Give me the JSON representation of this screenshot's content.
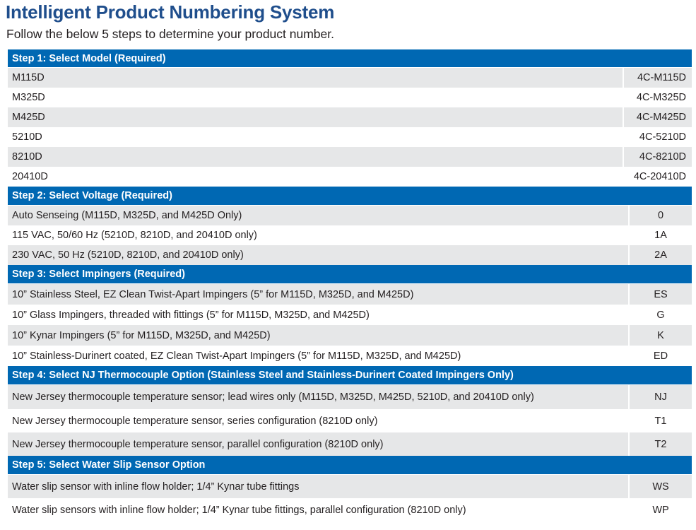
{
  "title": "Intelligent Product Numbering System",
  "subtitle": "Follow the below 5 steps to determine your product number.",
  "colors": {
    "header_bg": "#0068b3",
    "title": "#1f4e8c",
    "row_shade": "#e6e7e8"
  },
  "steps": [
    {
      "label": "Step 1:  Select Model (Required)",
      "rows": [
        {
          "desc": "M115D",
          "code": "4C-M115D"
        },
        {
          "desc": "M325D",
          "code": "4C-M325D"
        },
        {
          "desc": "M425D",
          "code": "4C-M425D"
        },
        {
          "desc": "5210D",
          "code": "4C-5210D"
        },
        {
          "desc": "8210D",
          "code": "4C-8210D"
        },
        {
          "desc": "20410D",
          "code": "4C-20410D"
        }
      ]
    },
    {
      "label": "Step 2:  Select Voltage (Required)",
      "rows": [
        {
          "desc": "Auto Senseing (M115D, M325D, and M425D Only)",
          "code": "0"
        },
        {
          "desc": "115 VAC, 50/60 Hz (5210D, 8210D, and 20410D only)",
          "code": "1A"
        },
        {
          "desc": "230 VAC, 50 Hz (5210D, 8210D, and 20410D only)",
          "code": "2A"
        }
      ]
    },
    {
      "label": "Step 3: Select Impingers (Required)",
      "rows": [
        {
          "desc": "10” Stainless Steel, EZ Clean Twist-Apart Impingers (5” for M115D, M325D, and M425D)",
          "code": "ES"
        },
        {
          "desc": "10” Glass Impingers, threaded with fittings (5” for M115D, M325D, and M425D)",
          "code": "G"
        },
        {
          "desc": "10” Kynar Impingers (5” for M115D, M325D, and M425D)",
          "code": "K"
        },
        {
          "desc": "10” Stainless-Durinert coated, EZ Clean Twist-Apart Impingers (5” for M115D, M325D, and M425D)",
          "code": "ED"
        }
      ]
    },
    {
      "label": "Step 4:  Select NJ Thermocouple Option (Stainless Steel and Stainless-Durinert Coated Impingers Only)",
      "rows": [
        {
          "desc": "New Jersey thermocouple temperature sensor; lead wires only (M115D, M325D, M425D, 5210D, and 20410D only)",
          "code": "NJ"
        },
        {
          "desc": "New Jersey thermocouple temperature sensor, series configuration (8210D only)",
          "code": "T1"
        },
        {
          "desc": "New Jersey thermocouple temperature sensor, parallel configuration (8210D only)",
          "code": "T2"
        }
      ]
    },
    {
      "label": "Step 5:  Select Water Slip Sensor Option",
      "rows": [
        {
          "desc": "Water slip sensor with inline flow holder; 1/4” Kynar tube fittings",
          "code": "WS"
        },
        {
          "desc": "Water slip sensors with inline flow holder; 1/4” Kynar tube fittings, parallel configuration (8210D only)",
          "code": "WP"
        }
      ]
    }
  ]
}
